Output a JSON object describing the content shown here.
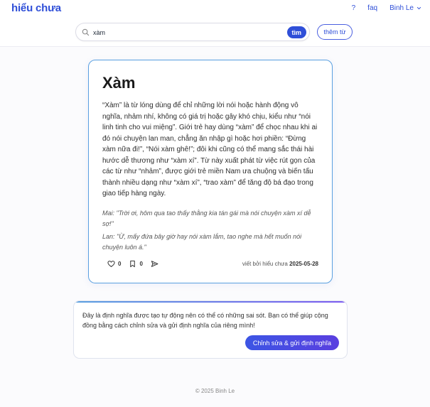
{
  "header": {
    "logo": "hiểu chưa",
    "help": "?",
    "faq": "faq",
    "user": "Binh Le",
    "search_value": "xàm",
    "search_button": "tìm",
    "add_word": "thêm từ"
  },
  "entry": {
    "word": "Xàm",
    "definition": "“Xàm” là từ lóng dùng để chỉ những lời nói hoặc hành động vô nghĩa, nhảm nhí, không có giá trị hoặc gây khó chịu, kiểu như “nói linh tinh cho vui miệng”. Giới trẻ hay dùng “xàm” để chọc nhau khi ai đó nói chuyện lan man, chẳng ăn nhập gì hoặc hơi phiền: “Đừng xàm nữa đi!”, “Nói xàm ghê!”; đôi khi cũng có thể mang sắc thái hài hước dễ thương như “xàm xí”. Từ này xuất phát từ việc rút gọn của các từ như “nhảm”, được giới trẻ miền Nam ưa chuộng và biến tấu thành nhiều dạng như “xàm xí”, “trao xàm” để tăng độ bá đạo trong giao tiếp hàng ngày.",
    "example_1": "Mai: \"Trời ơi, hôm qua tao thấy thằng kia tán gái mà nói chuyện xàm xí dễ sợ!\"",
    "example_2": "Lan: \"Ừ, mấy đứa bây giờ hay nói xàm lắm, tao nghe mà hết muốn nói chuyện luôn á.\"",
    "likes": "0",
    "saves": "0",
    "byline_prefix": "viết bởi hiểu chưa",
    "date": "2025-05-28"
  },
  "notice": {
    "text": "Đây là định nghĩa được tạo tự động nên có thể có những sai sót. Bạn có thể giúp cộng đồng bằng cách chỉnh sửa và gửi định nghĩa của riêng mình!",
    "button": "Chỉnh sửa & gửi định nghĩa"
  },
  "footer": {
    "text": "© 2025 Binh Le"
  },
  "colors": {
    "brand": "#2f4fd8",
    "card_border": "#5aa0e0"
  }
}
